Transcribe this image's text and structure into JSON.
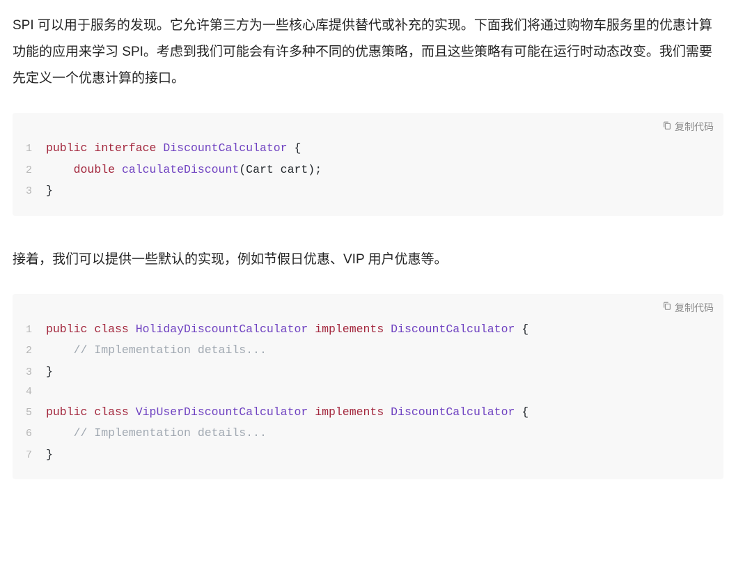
{
  "para1": "SPI 可以用于服务的发现。它允许第三方为一些核心库提供替代或补充的实现。下面我们将通过购物车服务里的优惠计算功能的应用来学习 SPI。考虑到我们可能会有许多种不同的优惠策略，而且这些策略有可能在运行时动态改变。我们需要先定义一个优惠计算的接口。",
  "para2": "接着，我们可以提供一些默认的实现，例如节假日优惠、VIP 用户优惠等。",
  "copy_label": "复制代码",
  "code1": {
    "lines": [
      [
        {
          "c": "kw",
          "t": "public"
        },
        {
          "c": "plain",
          "t": " "
        },
        {
          "c": "kw",
          "t": "interface"
        },
        {
          "c": "plain",
          "t": " "
        },
        {
          "c": "type",
          "t": "DiscountCalculator"
        },
        {
          "c": "plain",
          "t": " "
        },
        {
          "c": "punct",
          "t": "{"
        }
      ],
      [
        {
          "c": "plain",
          "t": "    "
        },
        {
          "c": "kw",
          "t": "double"
        },
        {
          "c": "plain",
          "t": " "
        },
        {
          "c": "func",
          "t": "calculateDiscount"
        },
        {
          "c": "punct",
          "t": "("
        },
        {
          "c": "plain",
          "t": "Cart cart"
        },
        {
          "c": "punct",
          "t": ")"
        },
        {
          "c": "punct",
          "t": ";"
        }
      ],
      [
        {
          "c": "punct",
          "t": "}"
        }
      ]
    ]
  },
  "code2": {
    "lines": [
      [
        {
          "c": "kw",
          "t": "public"
        },
        {
          "c": "plain",
          "t": " "
        },
        {
          "c": "kw",
          "t": "class"
        },
        {
          "c": "plain",
          "t": " "
        },
        {
          "c": "type",
          "t": "HolidayDiscountCalculator"
        },
        {
          "c": "plain",
          "t": " "
        },
        {
          "c": "kw",
          "t": "implements"
        },
        {
          "c": "plain",
          "t": " "
        },
        {
          "c": "type",
          "t": "DiscountCalculator"
        },
        {
          "c": "plain",
          "t": " "
        },
        {
          "c": "punct",
          "t": "{"
        }
      ],
      [
        {
          "c": "plain",
          "t": "    "
        },
        {
          "c": "comment",
          "t": "// Implementation details..."
        }
      ],
      [
        {
          "c": "punct",
          "t": "}"
        }
      ],
      [
        {
          "c": "plain",
          "t": ""
        }
      ],
      [
        {
          "c": "kw",
          "t": "public"
        },
        {
          "c": "plain",
          "t": " "
        },
        {
          "c": "kw",
          "t": "class"
        },
        {
          "c": "plain",
          "t": " "
        },
        {
          "c": "type",
          "t": "VipUserDiscountCalculator"
        },
        {
          "c": "plain",
          "t": " "
        },
        {
          "c": "kw",
          "t": "implements"
        },
        {
          "c": "plain",
          "t": " "
        },
        {
          "c": "type",
          "t": "DiscountCalculator"
        },
        {
          "c": "plain",
          "t": " "
        },
        {
          "c": "punct",
          "t": "{"
        }
      ],
      [
        {
          "c": "plain",
          "t": "    "
        },
        {
          "c": "comment",
          "t": "// Implementation details..."
        }
      ],
      [
        {
          "c": "punct",
          "t": "}"
        }
      ]
    ]
  }
}
